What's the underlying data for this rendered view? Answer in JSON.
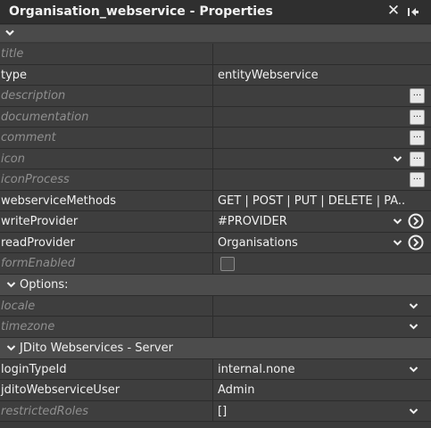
{
  "window": {
    "title": "Organisation_webservice - Properties",
    "close_glyph": "✕"
  },
  "properties": [
    {
      "name": "title",
      "value": "",
      "dim": true,
      "controls": []
    },
    {
      "name": "type",
      "value": "entityWebservice",
      "dim": false,
      "controls": []
    },
    {
      "name": "description",
      "value": "",
      "dim": true,
      "controls": [
        "dots"
      ]
    },
    {
      "name": "documentation",
      "value": "",
      "dim": true,
      "controls": [
        "dots"
      ]
    },
    {
      "name": "comment",
      "value": "",
      "dim": true,
      "controls": [
        "dots"
      ]
    },
    {
      "name": "icon",
      "value": "",
      "dim": true,
      "controls": [
        "dropdown",
        "dots"
      ]
    },
    {
      "name": "iconProcess",
      "value": "",
      "dim": true,
      "controls": [
        "dots"
      ]
    },
    {
      "name": "webserviceMethods",
      "value": "GET | POST | PUT | DELETE | PA...",
      "dim": false,
      "controls": []
    },
    {
      "name": "writeProvider",
      "value": "#PROVIDER",
      "dim": false,
      "controls": [
        "dropdown",
        "go"
      ]
    },
    {
      "name": "readProvider",
      "value": "Organisations",
      "dim": false,
      "controls": [
        "dropdown",
        "go"
      ]
    },
    {
      "name": "formEnabled",
      "value": "",
      "dim": true,
      "controls": [
        "checkbox"
      ]
    }
  ],
  "sections": [
    {
      "label": "Options:",
      "properties": [
        {
          "name": "locale",
          "value": "",
          "dim": true,
          "controls": [
            "dropdown-far"
          ]
        },
        {
          "name": "timezone",
          "value": "",
          "dim": true,
          "controls": [
            "dropdown-far"
          ]
        }
      ]
    },
    {
      "label": "JDito Webservices - Server",
      "properties": [
        {
          "name": "loginTypeId",
          "value": "internal.none",
          "dim": false,
          "controls": [
            "dropdown-far"
          ]
        },
        {
          "name": "jditoWebserviceUser",
          "value": "Admin",
          "dim": false,
          "controls": []
        },
        {
          "name": "restrictedRoles",
          "value": "[]",
          "dim": true,
          "controls": [
            "dropdown-far"
          ]
        }
      ]
    }
  ],
  "icons": {
    "close": "close-icon",
    "pin": "pin-icon",
    "collapse": "chevron-down-icon",
    "dropdown": "dropdown-arrow-icon",
    "ellipsis": "ellipsis-icon",
    "navigate": "navigate-arrow-icon"
  },
  "ellipsis_glyph": "..."
}
